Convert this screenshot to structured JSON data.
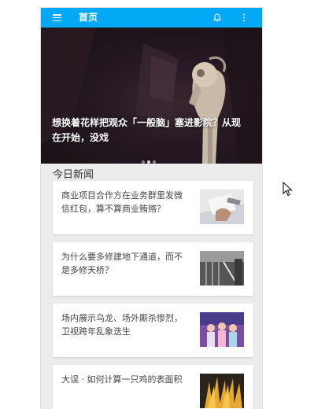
{
  "appbar": {
    "title": "首页",
    "menu_icon": "menu-icon",
    "bell_icon": "bell-icon",
    "more_icon": "more-vertical-icon",
    "color": "#03a9f4"
  },
  "hero": {
    "title": "想换着花样把观众「一般脑」塞进影院？从现在开始，没戏",
    "slide_count": 3,
    "active_slide": 2
  },
  "section": {
    "title": "今日新闻"
  },
  "news": [
    {
      "title": "商业项目合作方在业务群里发微信红包，算不算商业贿赂？",
      "thumb": "business-photo"
    },
    {
      "title": "为什么要多修建地下通道，而不是多修天桥？",
      "thumb": "underpass-photo"
    },
    {
      "title": "场内展示乌龙、场外厮杀惨烈，卫视跨年乱象迭生",
      "thumb": "stage-photo"
    },
    {
      "title": "大误 · 如何计算一只鸡的表面积",
      "thumb": "chicken-photo"
    }
  ]
}
